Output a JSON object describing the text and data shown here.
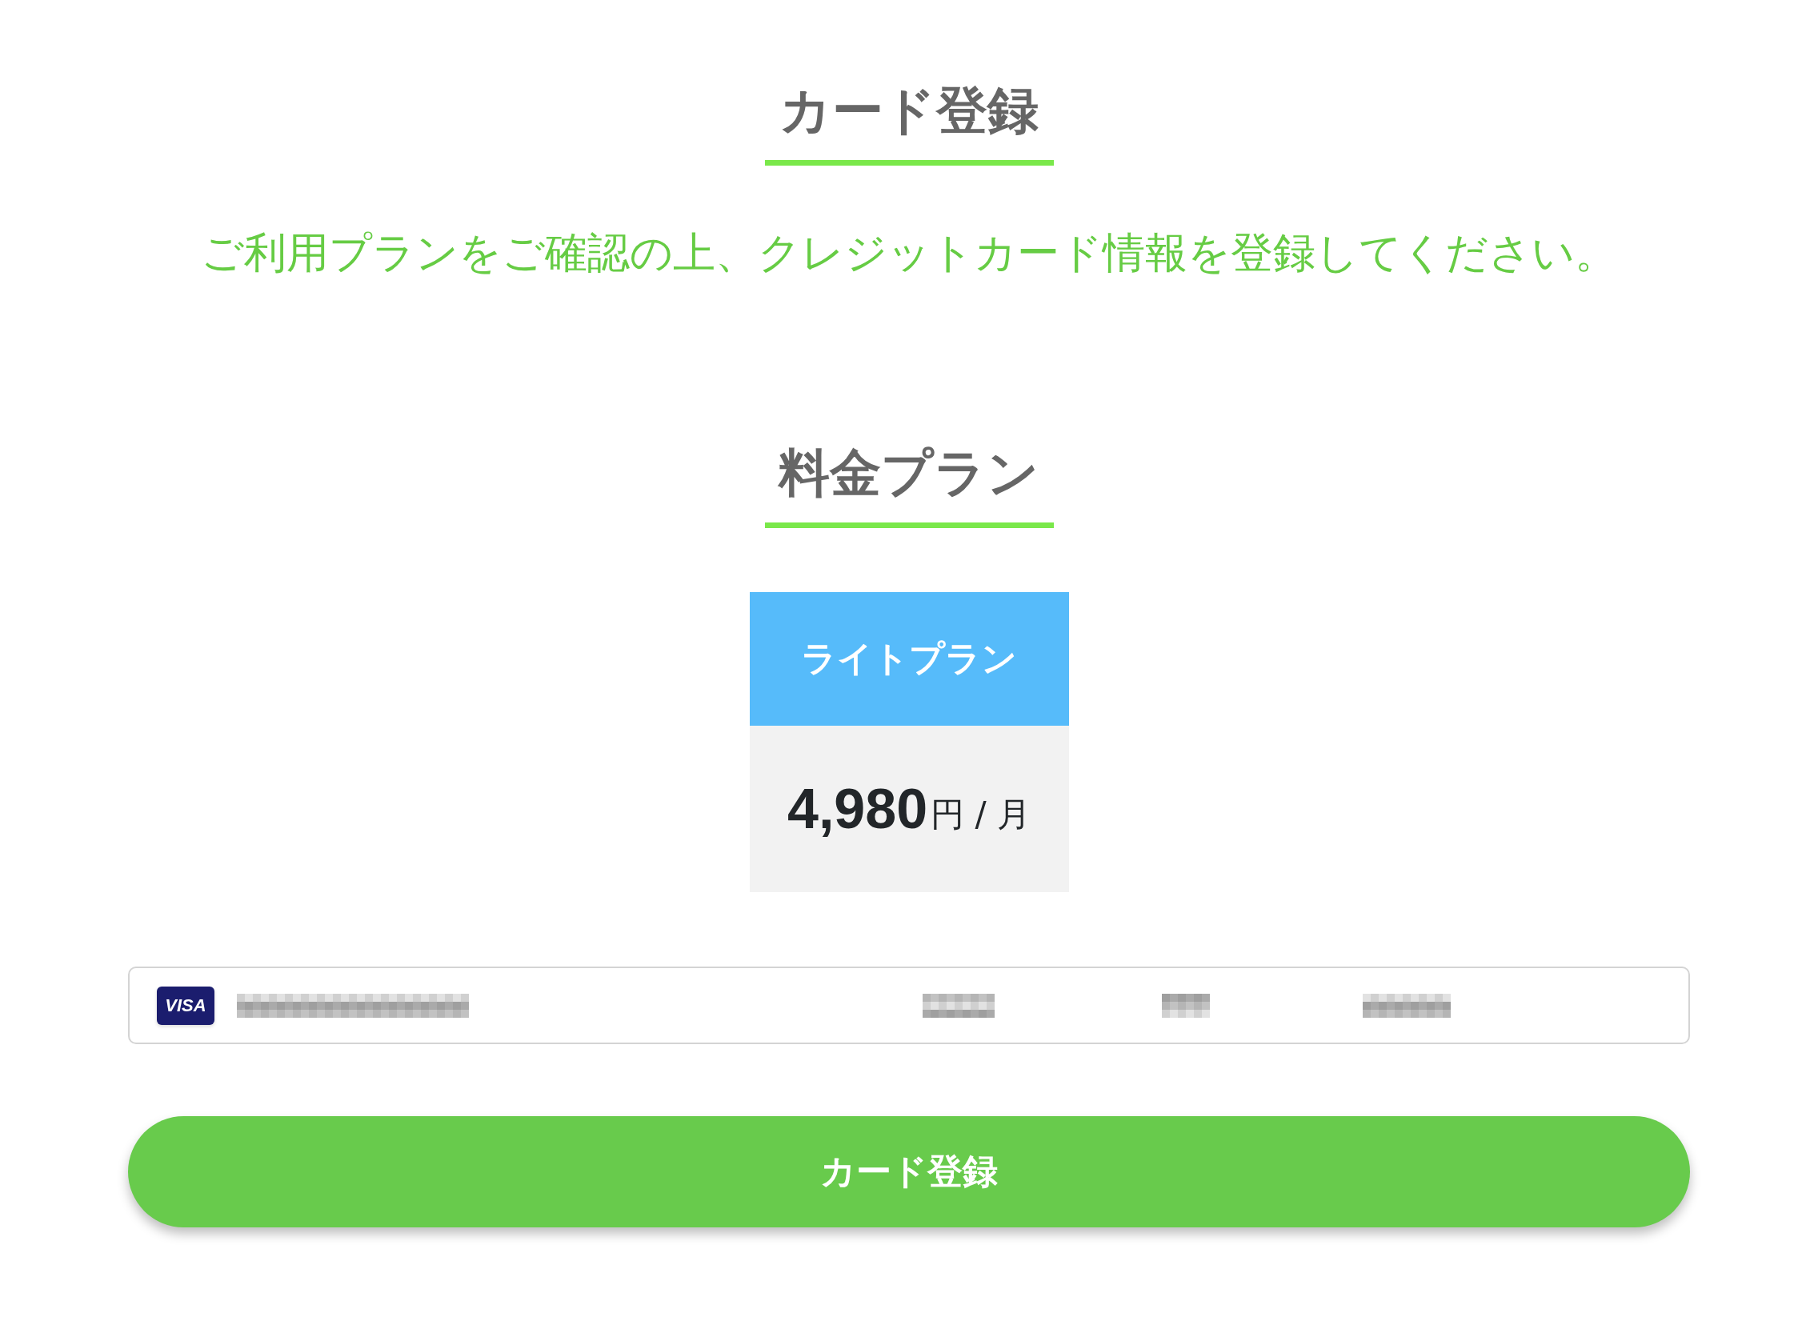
{
  "title": "カード登録",
  "message": "ご利用プランをご確認の上、クレジットカード情報を登録してください。",
  "plan_section": {
    "title": "料金プラン",
    "plans": [
      {
        "name": "ライトプラン",
        "amount": "4,980",
        "unit": "円 / 月"
      }
    ]
  },
  "card_field": {
    "brand": "VISA"
  },
  "submit_button": "カード登録"
}
